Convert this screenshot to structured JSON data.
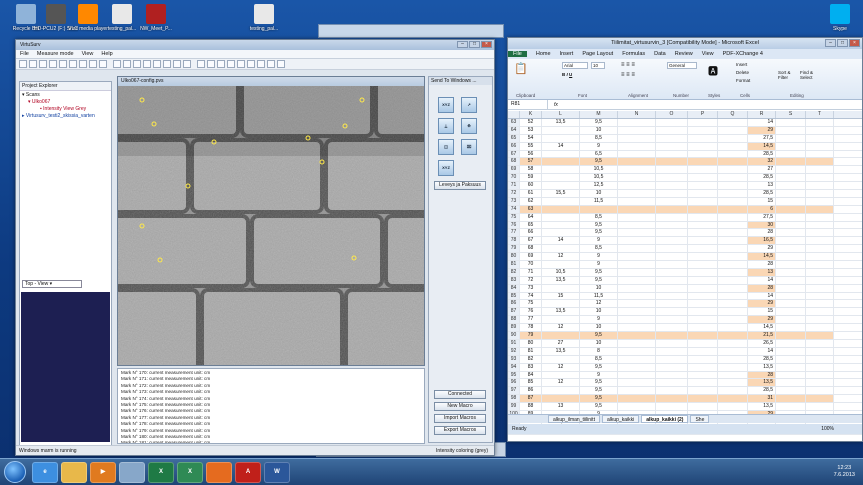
{
  "desktop": {
    "icons": [
      {
        "label": "Recycle Bin",
        "name": "recycle-bin-icon",
        "color": "#8fb3d9"
      },
      {
        "label": "HD-PCU2 (F:) Shortcut",
        "name": "drive-shortcut-icon",
        "color": "#555555"
      },
      {
        "label": "VLC media player",
        "name": "vlc-icon",
        "color": "#ff8800"
      },
      {
        "label": "testing_pal...",
        "name": "document-icon",
        "color": "#e8e8e8"
      },
      {
        "label": "NW_Meet_P...",
        "name": "presentation-icon",
        "color": "#b02020"
      },
      {
        "label": "testing_pal...",
        "name": "document-icon",
        "color": "#e8e8e8"
      },
      {
        "label": "Skype",
        "name": "skype-icon",
        "color": "#00aff0"
      }
    ]
  },
  "virtusurv": {
    "title": "VirtuSurv",
    "menu": [
      "File",
      "Measure mode",
      "View",
      "Help"
    ],
    "project_explorer_label": "Project Explorer",
    "tree": [
      "Scans",
      "Ulko067",
      "Intensity View Grey",
      "Virtusurv_testi2_skissia_varten"
    ],
    "view_select": "Top - View",
    "viewport_title": "Ulko067-config.pvs",
    "log_lines": [
      "Mark N° 170:  current measurement unit: cm",
      "Mark N° 171:  current measurement unit: cm",
      "Mark N° 172:  current measurement unit: cm",
      "Mark N° 173:  current measurement unit: cm",
      "Mark N° 174:  current measurement unit: cm",
      "Mark N° 175:  current measurement unit: cm",
      "Mark N° 176:  current measurement unit: cm",
      "Mark N° 177:  current measurement unit: cm",
      "Mark N° 178:  current measurement unit: cm",
      "Mark N° 179:  current measurement unit: cm",
      "Mark N° 180:  current measurement unit: cm",
      "Mark N° 181:  current measurement unit: cm",
      "Mark N° 182:  current measurement unit: cm"
    ],
    "send_panel_title": "Send To Windows ...",
    "xyz_label": "XYZ",
    "leveys_button": "Leveys ja Paksuus",
    "buttons": {
      "connected": "Connected",
      "new_macro": "New Macro",
      "import_macros": "Import Macros",
      "export_macros": "Export Macros"
    },
    "status_left": "Windows marm is running",
    "status_right": "Intensity coloring (grey)"
  },
  "excel": {
    "title": "Tiilimitat_virtusurvin_3 [Compatibility Mode] - Microsoft Excel",
    "tabs": [
      "File",
      "Home",
      "Insert",
      "Page Layout",
      "Formulas",
      "Data",
      "Review",
      "View",
      "PDF-XChange 4"
    ],
    "font_name": "Arial",
    "font_size": "10",
    "number_format": "General",
    "ribbon_groups": [
      "Clipboard",
      "Font",
      "Alignment",
      "Number",
      "Styles",
      "Cells",
      "Editing"
    ],
    "ribbon_cells": [
      "Insert",
      "Delete",
      "Format"
    ],
    "ribbon_editing": [
      "Sort &",
      "Find &",
      "Filter",
      "Select"
    ],
    "name_box": "R81",
    "fx": "fx",
    "columns": [
      "K",
      "L",
      "M",
      "N",
      "O",
      "P",
      "Q",
      "R",
      "S",
      "T"
    ],
    "rows": [
      {
        "r": "63",
        "k": "52",
        "l": "13,5",
        "m": "9,5",
        "rv": "14",
        "hl": false,
        "rh": false
      },
      {
        "r": "64",
        "k": "53",
        "l": "",
        "m": "10",
        "rv": "29",
        "hl": false,
        "rh": true
      },
      {
        "r": "65",
        "k": "54",
        "l": "",
        "m": "8,5",
        "rv": "27,5",
        "hl": false,
        "rh": false
      },
      {
        "r": "66",
        "k": "55",
        "l": "14",
        "m": "9",
        "rv": "14,5",
        "hl": false,
        "rh": true
      },
      {
        "r": "67",
        "k": "56",
        "l": "",
        "m": "6,5",
        "rv": "28,5",
        "hl": false,
        "rh": false
      },
      {
        "r": "68",
        "k": "57",
        "l": "",
        "m": "9,5",
        "rv": "32",
        "hl": true,
        "rh": true
      },
      {
        "r": "69",
        "k": "58",
        "l": "",
        "m": "10,5",
        "rv": "27",
        "hl": false,
        "rh": false
      },
      {
        "r": "70",
        "k": "59",
        "l": "",
        "m": "10,5",
        "rv": "28,5",
        "hl": false,
        "rh": false
      },
      {
        "r": "71",
        "k": "60",
        "l": "",
        "m": "12,5",
        "rv": "13",
        "hl": false,
        "rh": false
      },
      {
        "r": "72",
        "k": "61",
        "l": "15,5",
        "m": "10",
        "rv": "28,5",
        "hl": false,
        "rh": false
      },
      {
        "r": "73",
        "k": "62",
        "l": "",
        "m": "11,5",
        "rv": "15",
        "hl": false,
        "rh": false
      },
      {
        "r": "74",
        "k": "63",
        "l": "",
        "m": "",
        "rv": "6",
        "hl": true,
        "rh": true
      },
      {
        "r": "75",
        "k": "64",
        "l": "",
        "m": "8,5",
        "rv": "27,5",
        "hl": false,
        "rh": false
      },
      {
        "r": "76",
        "k": "65",
        "l": "",
        "m": "9,5",
        "rv": "30",
        "hl": false,
        "rh": true
      },
      {
        "r": "77",
        "k": "66",
        "l": "",
        "m": "9,5",
        "rv": "28",
        "hl": false,
        "rh": false
      },
      {
        "r": "78",
        "k": "67",
        "l": "14",
        "m": "9",
        "rv": "16,5",
        "hl": false,
        "rh": true
      },
      {
        "r": "79",
        "k": "68",
        "l": "",
        "m": "8,5",
        "rv": "29",
        "hl": false,
        "rh": false
      },
      {
        "r": "80",
        "k": "69",
        "l": "12",
        "m": "9",
        "rv": "14,5",
        "hl": false,
        "rh": true
      },
      {
        "r": "81",
        "k": "70",
        "l": "",
        "m": "9",
        "rv": "28",
        "hl": false,
        "rh": false
      },
      {
        "r": "82",
        "k": "71",
        "l": "10,5",
        "m": "9,5",
        "rv": "13",
        "hl": false,
        "rh": true
      },
      {
        "r": "83",
        "k": "72",
        "l": "13,5",
        "m": "9,5",
        "rv": "14",
        "hl": false,
        "rh": false
      },
      {
        "r": "84",
        "k": "73",
        "l": "",
        "m": "10",
        "rv": "28",
        "hl": false,
        "rh": true
      },
      {
        "r": "85",
        "k": "74",
        "l": "15",
        "m": "11,5",
        "rv": "14",
        "hl": false,
        "rh": false
      },
      {
        "r": "86",
        "k": "75",
        "l": "",
        "m": "12",
        "rv": "29",
        "hl": false,
        "rh": true
      },
      {
        "r": "87",
        "k": "76",
        "l": "13,5",
        "m": "10",
        "rv": "15",
        "hl": false,
        "rh": false
      },
      {
        "r": "88",
        "k": "77",
        "l": "",
        "m": "9",
        "rv": "29",
        "hl": false,
        "rh": true
      },
      {
        "r": "89",
        "k": "78",
        "l": "12",
        "m": "10",
        "rv": "14,5",
        "hl": false,
        "rh": false
      },
      {
        "r": "90",
        "k": "79",
        "l": "",
        "m": "9,5",
        "rv": "21,5",
        "hl": true,
        "rh": true
      },
      {
        "r": "91",
        "k": "80",
        "l": "27",
        "m": "10",
        "rv": "26,5",
        "hl": false,
        "rh": false
      },
      {
        "r": "92",
        "k": "81",
        "l": "13,5",
        "m": "8",
        "rv": "14",
        "hl": false,
        "rh": false
      },
      {
        "r": "93",
        "k": "82",
        "l": "",
        "m": "8,5",
        "rv": "28,5",
        "hl": false,
        "rh": false
      },
      {
        "r": "94",
        "k": "83",
        "l": "12",
        "m": "9,5",
        "rv": "13,5",
        "hl": false,
        "rh": false
      },
      {
        "r": "95",
        "k": "84",
        "l": "",
        "m": "9",
        "rv": "28",
        "hl": false,
        "rh": true
      },
      {
        "r": "96",
        "k": "85",
        "l": "12",
        "m": "9,5",
        "rv": "13,5",
        "hl": false,
        "rh": true
      },
      {
        "r": "97",
        "k": "86",
        "l": "",
        "m": "9,5",
        "rv": "28,5",
        "hl": false,
        "rh": false
      },
      {
        "r": "98",
        "k": "87",
        "l": "",
        "m": "9,5",
        "rv": "31",
        "hl": true,
        "rh": true
      },
      {
        "r": "99",
        "k": "88",
        "l": "13",
        "m": "9,5",
        "rv": "13,5",
        "hl": false,
        "rh": false
      },
      {
        "r": "100",
        "k": "89",
        "l": "",
        "m": "9",
        "rv": "29",
        "hl": false,
        "rh": true
      },
      {
        "r": "101",
        "k": "90",
        "l": "15,5",
        "m": "9",
        "rv": "",
        "hl": false,
        "rh": false
      },
      {
        "r": "102",
        "k": "91",
        "l": "",
        "m": "9,5",
        "rv": "",
        "hl": false,
        "rh": false
      }
    ],
    "sheet_tabs": [
      "alkup_ilman_tiilinitt",
      "alkup_kaikki",
      "alkup_kaikki (2)",
      "She"
    ],
    "active_sheet": 2,
    "status_left": "Ready",
    "zoom": "100%"
  },
  "taskbar": {
    "clock_time": "12:23",
    "clock_date": "7.6.2013",
    "apps": [
      {
        "name": "ie-icon",
        "glyph": "e",
        "color": "#3d8fe0"
      },
      {
        "name": "explorer-icon",
        "glyph": "",
        "color": "#e8b84a"
      },
      {
        "name": "media-player-icon",
        "glyph": "▶",
        "color": "#e07a1f"
      },
      {
        "name": "virtusurv-taskbar-icon",
        "glyph": "",
        "color": "#87a7c9"
      },
      {
        "name": "excel-taskbar-icon",
        "glyph": "X",
        "color": "#1f7a45"
      },
      {
        "name": "excel2-taskbar-icon",
        "glyph": "X",
        "color": "#2f8a55"
      },
      {
        "name": "firefox-icon",
        "glyph": "",
        "color": "#e56b1f"
      },
      {
        "name": "pdf-icon",
        "glyph": "A",
        "color": "#c0201a"
      },
      {
        "name": "word-icon",
        "glyph": "W",
        "color": "#2b579a"
      }
    ]
  },
  "colors": {
    "excel_highlight": "#fad7b5",
    "excel_green": "#1f6e43",
    "wall_dark": "#5a5a5a"
  }
}
